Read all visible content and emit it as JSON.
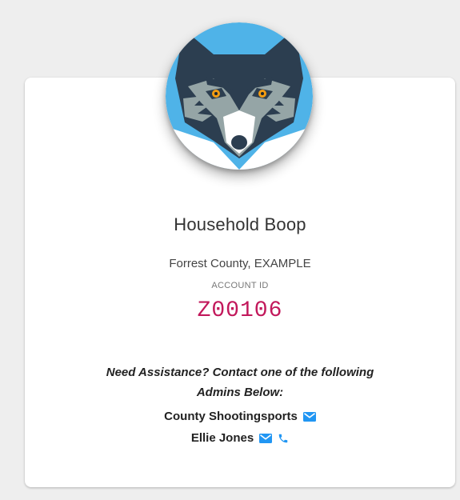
{
  "profile": {
    "name": "Household Boop",
    "location": "Forrest County, EXAMPLE",
    "account_id_label": "ACCOUNT ID",
    "account_id": "Z00106"
  },
  "assistance": {
    "line1": "Need Assistance? Contact one of the following",
    "line2": "Admins Below:"
  },
  "admins": [
    {
      "name": "County Shootingsports",
      "icons": [
        "mail-icon"
      ]
    },
    {
      "name": "Ellie Jones",
      "icons": [
        "mail-icon",
        "phone-icon"
      ]
    }
  ],
  "colors": {
    "page_background": "#eeeeee",
    "card_background": "#ffffff",
    "account_id": "#c2185b",
    "icon_blue": "#2196f3",
    "avatar_background": "#4fb3e8",
    "wolf_dark": "#2c3e50",
    "wolf_gray": "#95a5a6",
    "wolf_eye": "#f39c12"
  }
}
